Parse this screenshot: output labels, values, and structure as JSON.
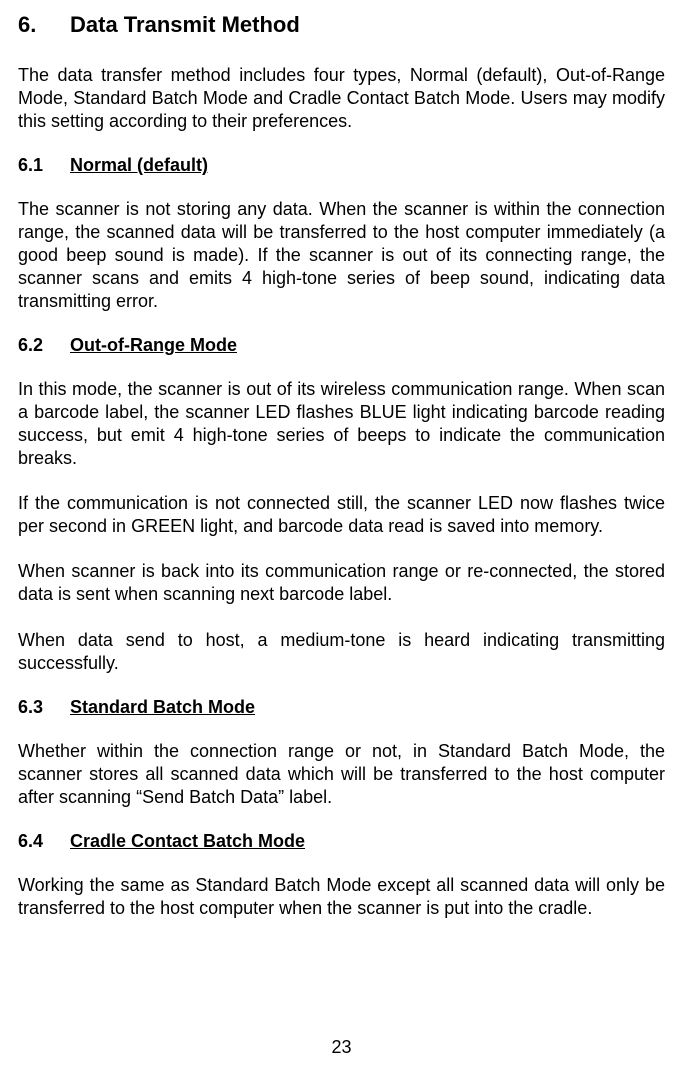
{
  "section": {
    "number": "6.",
    "title": "Data Transmit Method",
    "intro": "The data transfer method includes four types, Normal (default), Out-of-Range Mode, Standard Batch Mode and Cradle Contact Batch Mode. Users may modify this setting according to their preferences."
  },
  "sub1": {
    "number": "6.1",
    "title": "Normal (default)",
    "p1": "The scanner is not storing any data. When the scanner is within the connection range, the scanned data will be transferred to the host computer immediately (a good beep sound is made). If the scanner is out of its connecting range, the scanner scans and emits 4 high-tone series of beep sound, indicating data transmitting error."
  },
  "sub2": {
    "number": "6.2",
    "title": "Out-of-Range Mode",
    "p1": "In this mode, the scanner is out of its wireless communication range. When scan a barcode label, the scanner LED flashes BLUE light indicating barcode reading success, but emit 4 high-tone series of beeps to indicate the communication breaks.",
    "p2": "If the communication is not connected still, the scanner LED now flashes twice per second in GREEN light, and barcode data read is saved into memory.",
    "p3": "When scanner is back into its communication range or re-connected, the stored data is sent when scanning next barcode label.",
    "p4": "When data send to host, a medium-tone is heard indicating transmitting successfully."
  },
  "sub3": {
    "number": "6.3",
    "title": "Standard Batch Mode",
    "p1": "Whether within the connection range or not, in Standard Batch Mode, the scanner stores all scanned data which will be transferred to the host computer after scanning “Send Batch Data” label."
  },
  "sub4": {
    "number": "6.4",
    "title": "Cradle Contact Batch Mode",
    "p1": "Working the same as Standard Batch Mode except all scanned data will only be transferred to the host computer when the scanner is put into the cradle."
  },
  "pageNumber": "23"
}
